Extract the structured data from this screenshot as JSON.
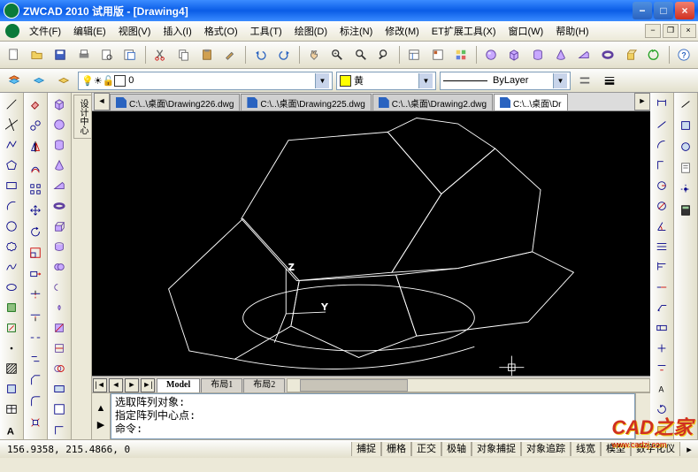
{
  "title": "ZWCAD 2010 试用版 - [Drawing4]",
  "menu": [
    "文件(F)",
    "编辑(E)",
    "视图(V)",
    "插入(I)",
    "格式(O)",
    "工具(T)",
    "绘图(D)",
    "标注(N)",
    "修改(M)",
    "ET扩展工具(X)",
    "窗口(W)",
    "帮助(H)"
  ],
  "layer": {
    "current": "0"
  },
  "color_dd": {
    "label": "黄",
    "swatch": "#ffff00"
  },
  "linetype_dd": {
    "label": "ByLayer"
  },
  "file_tabs": [
    {
      "label": "C:\\..\\桌面\\Drawing226.dwg",
      "active": false
    },
    {
      "label": "C:\\..\\桌面\\Drawing225.dwg",
      "active": false
    },
    {
      "label": "C:\\..\\桌面\\Drawing2.dwg",
      "active": false
    },
    {
      "label": "C:\\..\\桌面\\Dr",
      "active": true
    }
  ],
  "ucs": {
    "x_label": "Y",
    "z_label": "Z"
  },
  "sheet_tabs": [
    {
      "label": "Model",
      "active": true
    },
    {
      "label": "布局1",
      "active": false
    },
    {
      "label": "布局2",
      "active": false
    }
  ],
  "command_lines": [
    "选取阵列对象:",
    "指定阵列中心点:",
    "命令:"
  ],
  "coords": "156.9358,  215.4866,  0",
  "status_toggles": [
    "捕捉",
    "栅格",
    "正交",
    "极轴",
    "对象捕捉",
    "对象追踪",
    "线宽",
    "模型",
    "数字化仪"
  ],
  "watermark": {
    "line1": "CAD之家",
    "line2": "www.cadzj.com"
  }
}
